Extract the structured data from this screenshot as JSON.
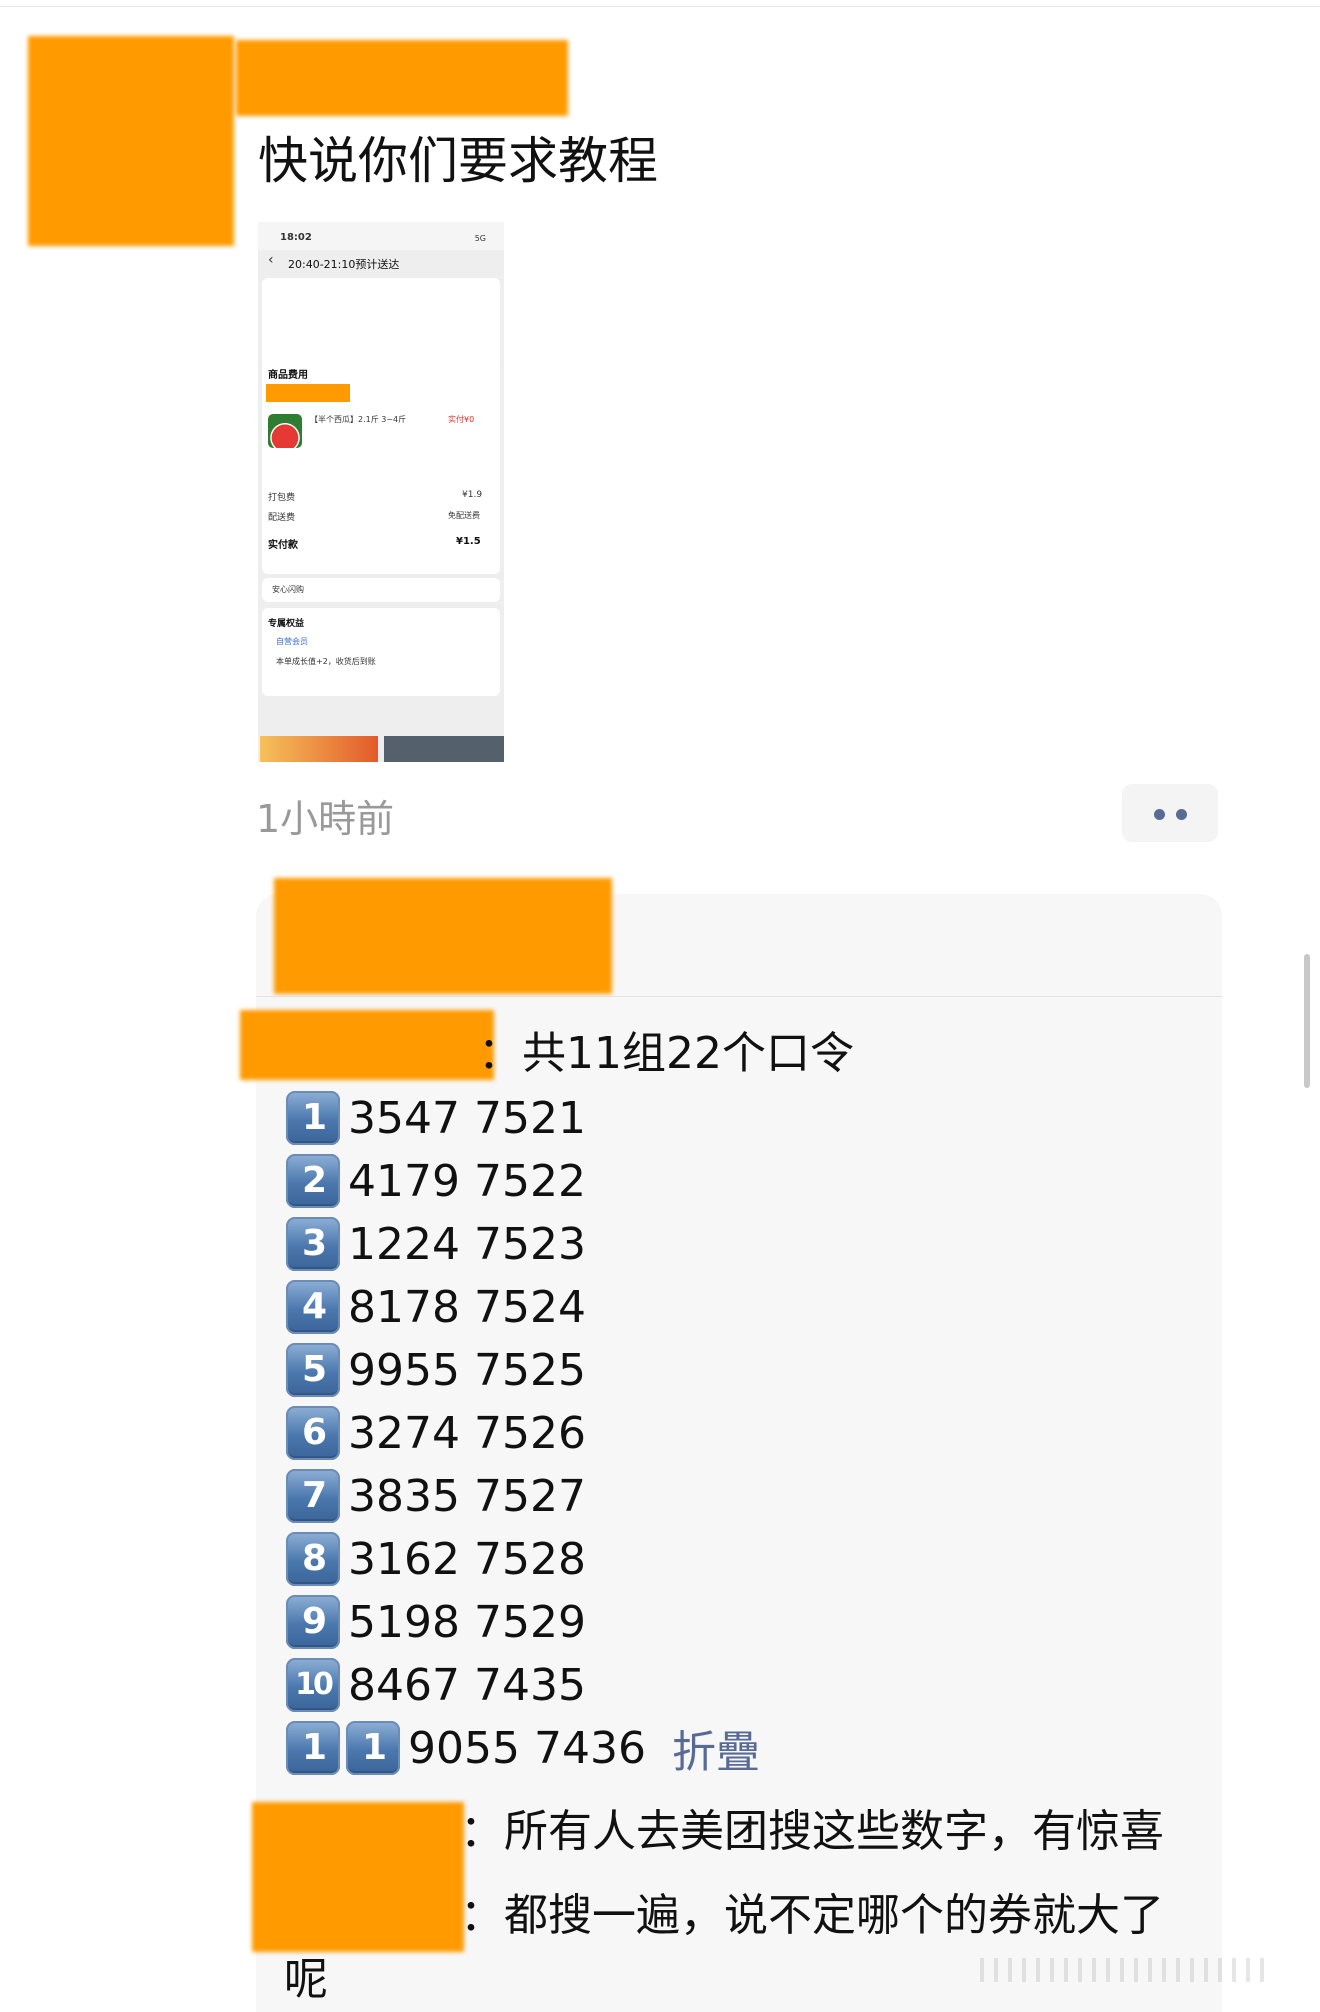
{
  "post": {
    "text": "快说你们要求教程",
    "time_ago": "1小時前"
  },
  "screenshot": {
    "status_time": "18:02",
    "status_signal": "5G",
    "delivery_window": "20:40-21:10预计送达",
    "recipient_label": "商品费用",
    "item_title": "【半个西瓜】2.1斤 3~4斤",
    "item_qty": "实付¥0",
    "packing_fee_label": "打包费",
    "packing_fee": "¥1.9",
    "delivery_fee_label": "配送费",
    "delivery_fee": "免配送费",
    "paid_label": "实付款",
    "paid_value": "¥1.5",
    "safe_label": "安心闪购",
    "benefit_label": "专属权益",
    "benefit_member": "自营会员",
    "benefit_text": "本单成长值+2，收货后到账"
  },
  "comment": {
    "intro": "：共11组22个口令",
    "codes": [
      {
        "index": "1",
        "number": "3547 7521"
      },
      {
        "index": "2",
        "number": "4179 7522"
      },
      {
        "index": "3",
        "number": "1224 7523"
      },
      {
        "index": "4",
        "number": "8178 7524"
      },
      {
        "index": "5",
        "number": "9955 7525"
      },
      {
        "index": "6",
        "number": "3274 7526"
      },
      {
        "index": "7",
        "number": "3835 7527"
      },
      {
        "index": "8",
        "number": "3162 7528"
      },
      {
        "index": "9",
        "number": "5198 7529"
      },
      {
        "index": "10",
        "number": "8467 7435"
      }
    ],
    "last_code": {
      "index_a": "1",
      "index_b": "1",
      "number": "9055 7436"
    },
    "fold_label": "折疊",
    "line1": "：所有人去美团搜这些数字，有惊喜",
    "line2": "：都搜一遍，说不定哪个的券就大了",
    "line3": "呢"
  },
  "colors": {
    "redaction": "#ff9a00",
    "link": "#576b95",
    "keycap": "#4a77ad"
  }
}
